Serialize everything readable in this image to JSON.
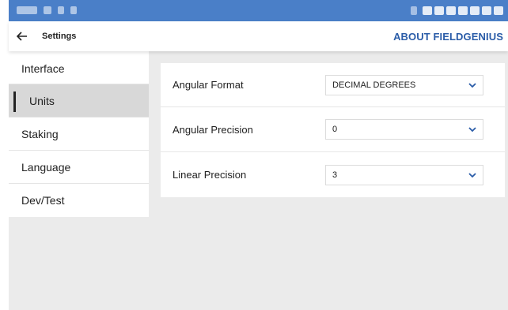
{
  "statusbar": {
    "color": "#4a7fc8"
  },
  "appbar": {
    "title": "Settings",
    "about_label": "ABOUT FIELDGENIUS",
    "accent": "#2a5ca8"
  },
  "sidebar": {
    "items": [
      {
        "label": "Interface",
        "active": false
      },
      {
        "label": "Units",
        "active": true
      },
      {
        "label": "Staking",
        "active": false
      },
      {
        "label": "Language",
        "active": false
      },
      {
        "label": "Dev/Test",
        "active": false
      }
    ]
  },
  "settings": {
    "angular_format": {
      "label": "Angular Format",
      "value": "DECIMAL DEGREES"
    },
    "angular_precision": {
      "label": "Angular Precision",
      "value": "0"
    },
    "linear_precision": {
      "label": "Linear Precision",
      "value": "3"
    }
  },
  "icons": {
    "back": "arrow-left-icon",
    "dropdown": "chevron-down-icon"
  }
}
